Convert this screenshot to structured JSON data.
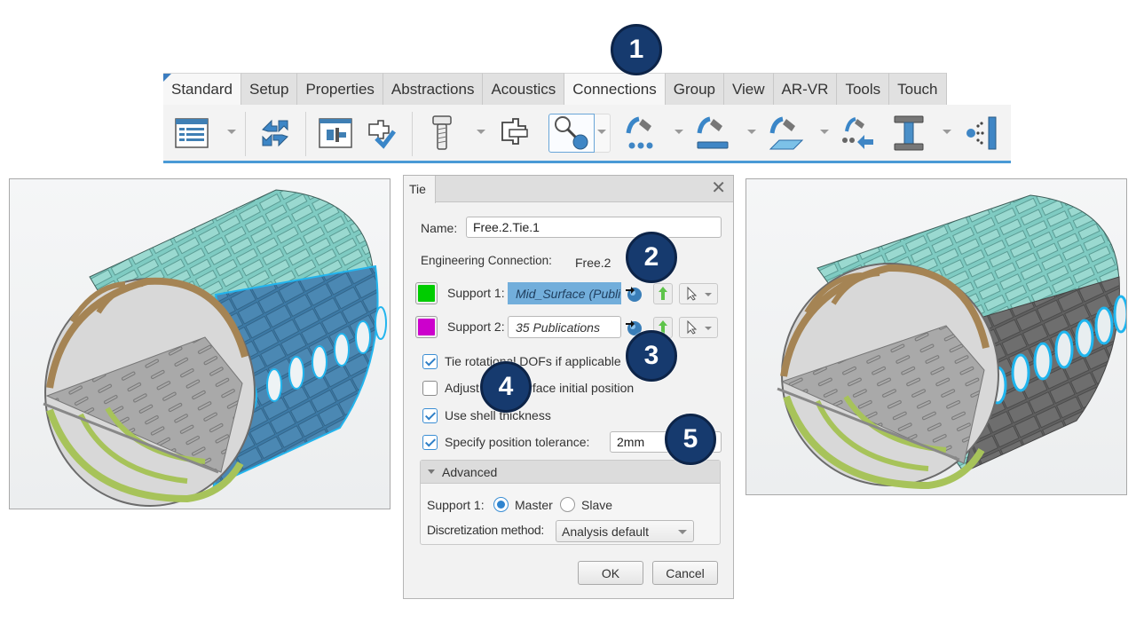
{
  "toolbar": {
    "tabs": [
      {
        "label": "Standard",
        "active": true
      },
      {
        "label": "Setup",
        "active": false
      },
      {
        "label": "Properties",
        "active": false
      },
      {
        "label": "Abstractions",
        "active": false
      },
      {
        "label": "Acoustics",
        "active": false
      },
      {
        "label": "Connections",
        "active": true
      },
      {
        "label": "Group",
        "active": false
      },
      {
        "label": "View",
        "active": false
      },
      {
        "label": "AR-VR",
        "active": false
      },
      {
        "label": "Tools",
        "active": false
      },
      {
        "label": "Touch",
        "active": false
      }
    ],
    "tools": [
      {
        "icon": "specification-tree-icon",
        "has_dropdown": true
      },
      {
        "icon": "update-cycle-icon",
        "has_dropdown": false
      },
      {
        "icon": "engineering-connection-icon",
        "has_dropdown": false
      },
      {
        "icon": "connection-check-icon",
        "has_dropdown": false
      },
      {
        "icon": "bolt-icon",
        "has_dropdown": true
      },
      {
        "icon": "clamp-connection-icon",
        "has_dropdown": false
      },
      {
        "icon": "tie-connection-icon",
        "has_dropdown": true,
        "selected": true
      },
      {
        "icon": "point-fastener-icon",
        "has_dropdown": true
      },
      {
        "icon": "line-fastener-icon",
        "has_dropdown": true
      },
      {
        "icon": "surface-fastener-icon",
        "has_dropdown": true
      },
      {
        "icon": "fastener-projection-icon",
        "has_dropdown": false
      },
      {
        "icon": "beam-connection-icon",
        "has_dropdown": true
      },
      {
        "icon": "distant-connection-icon",
        "has_dropdown": false
      }
    ]
  },
  "callouts": [
    "1",
    "2",
    "3",
    "4",
    "5"
  ],
  "dialog": {
    "title": "Tie",
    "close_icon": "close-icon",
    "name_label": "Name:",
    "name_value": "Free.2.Tie.1",
    "eng_conn_label": "Engineering Connection:",
    "eng_conn_value": "Free.2",
    "support1": {
      "label": "Support 1:",
      "value": "Mid_Surface (Publications)",
      "color": "#00cc00"
    },
    "support2": {
      "label": "Support 2:",
      "value": "35 Publications",
      "color": "#cc00cc"
    },
    "options": [
      {
        "label": "Tie rotational DOFs if applicable",
        "checked": true
      },
      {
        "label": "Adjust slave surface initial position",
        "checked": false
      },
      {
        "label": "Use shell thickness",
        "checked": true
      },
      {
        "label": "Specify position tolerance:",
        "checked": true
      }
    ],
    "tolerance_value": "2mm",
    "advanced": {
      "title": "Advanced",
      "support1_label": "Support 1:",
      "radio_master": "Master",
      "radio_slave": "Slave",
      "selected_role": "Master",
      "discretization_label": "Discretization method:",
      "discretization_value": "Analysis default"
    },
    "ok_label": "OK",
    "cancel_label": "Cancel"
  },
  "viewports": {
    "left": {
      "description": "Fuselage barrel model, Support 1 mid-surface skin panel highlighted"
    },
    "right": {
      "description": "Fuselage barrel model, window frames (Support 2) highlighted"
    }
  },
  "colors": {
    "callout_bg": "#163a6e",
    "highlight_blue": "#1fb5ee",
    "skin_teal": "#6cc3b8",
    "frame_brown": "#a58454",
    "ribbon_accent": "#4a9ad6"
  }
}
